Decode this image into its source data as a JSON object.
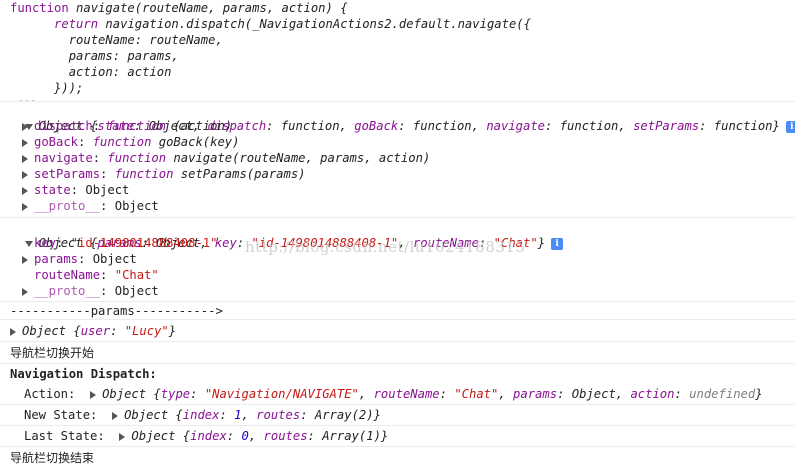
{
  "code_block": {
    "lines": [
      "function navigate(routeName, params, action) {",
      "      return navigation.dispatch(_NavigationActions2.default.navigate({",
      "        routeName: routeName,",
      "        params: params,",
      "        action: action",
      "      }));",
      "..."
    ]
  },
  "obj1": {
    "summary": "Object {state: Object, dispatch: function, goBack: function, navigate: function, setParams: function}",
    "props": [
      {
        "name": "dispatch",
        "value": "function (action)"
      },
      {
        "name": "goBack",
        "value": "function goBack(key)"
      },
      {
        "name": "navigate",
        "value": "function navigate(routeName, params, action)"
      },
      {
        "name": "setParams",
        "value": "function setParams(params)"
      },
      {
        "name": "state",
        "value": "Object"
      },
      {
        "name": "__proto__",
        "value": "Object"
      }
    ]
  },
  "obj2": {
    "summary": "Object {params: Object, key: \"id-1498014888408-1\", routeName: \"Chat\"}",
    "props": [
      {
        "name": "key",
        "value": "\"id-1498014888408-1\""
      },
      {
        "name": "params",
        "value": "Object"
      },
      {
        "name": "routeName",
        "value": "\"Chat\""
      },
      {
        "name": "__proto__",
        "value": "Object"
      }
    ]
  },
  "params_divider": "-----------params----------->",
  "obj3": {
    "summary": "Object {user: \"Lucy\"}"
  },
  "nav_start": "导航栏切换开始",
  "nav_dispatch": {
    "title": "Navigation Dispatch:",
    "action_label": "Action:",
    "action_value": "Object {type: \"Navigation/NAVIGATE\", routeName: \"Chat\", params: Object, action: undefined}",
    "new_state_label": "New State:",
    "new_state_value": "Object {index: 1, routes: Array(2)}",
    "last_state_label": "Last State:",
    "last_state_value": "Object {index: 0, routes: Array(1)}"
  },
  "nav_end": "导航栏切换结束",
  "watermark": "http://blog.csdn.net/lu1024188315",
  "icons": {
    "info": "info-icon",
    "expand": "triangle-down-icon",
    "collapse": "triangle-right-icon"
  },
  "colors": {
    "keyword": "#881391",
    "string": "#c41a16",
    "number": "#1c00cf",
    "info": "#4a8cf7"
  }
}
